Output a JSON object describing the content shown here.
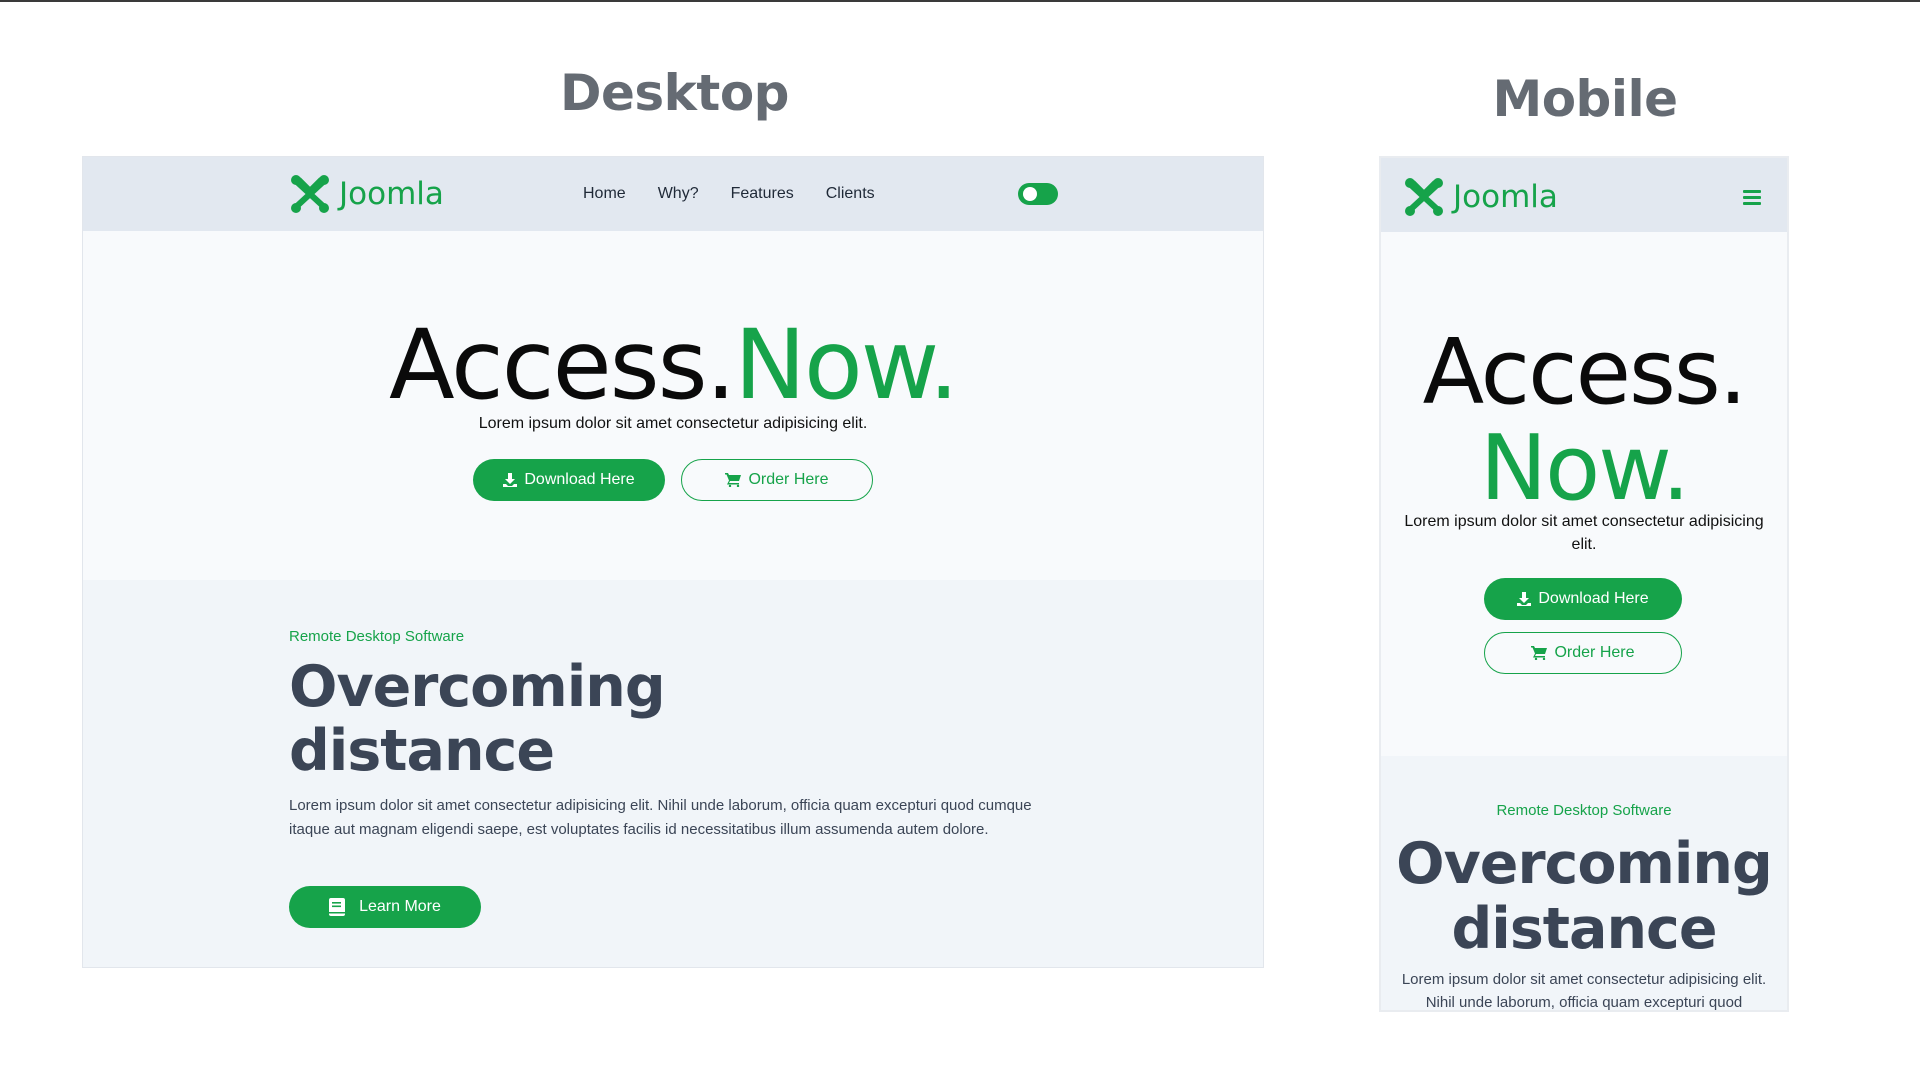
{
  "labels": {
    "desktop": "Desktop",
    "mobile": "Mobile"
  },
  "brand": {
    "name": "Joomla",
    "color": "#16a34a"
  },
  "nav": {
    "links": [
      "Home",
      "Why?",
      "Features",
      "Clients"
    ]
  },
  "hero": {
    "title_part1": "Access.",
    "title_part2": "Now.",
    "subtitle": "Lorem ipsum dolor sit amet consectetur adipisicing elit.",
    "download_label": "Download Here",
    "order_label": "Order Here"
  },
  "section": {
    "kicker": "Remote Desktop Software",
    "heading_line1": "Overcoming",
    "heading_line2": "distance",
    "paragraph": "Lorem ipsum dolor sit amet consectetur adipisicing elit. Nihil unde laborum, officia quam excepturi quod cumque itaque aut magnam eligendi saepe, est voluptates facilis id necessitatibus illum assumenda autem dolore.",
    "learn_more_label": "Learn More"
  },
  "icons": [
    "joomla-logo-icon",
    "toggle-switch",
    "download-icon",
    "cart-icon",
    "book-icon",
    "hamburger-menu-icon"
  ]
}
